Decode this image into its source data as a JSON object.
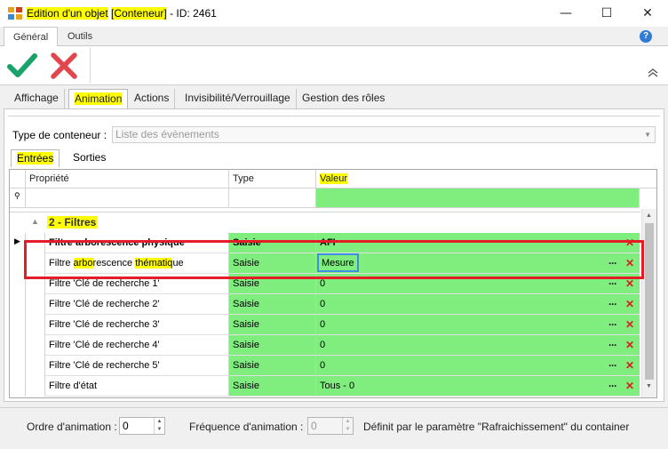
{
  "window": {
    "title_prefix": "Edition d'un ",
    "title_objet": "objet",
    "title_sep": " ",
    "title_conteneur": "[Conteneur]",
    "title_id": " - ID: 2461",
    "minimize": "—",
    "maximize": "☐",
    "close": "✕"
  },
  "ribbon": {
    "tabs": [
      "Général",
      "Outils"
    ],
    "help": "?"
  },
  "tabs": [
    "Affichage",
    "Animation",
    "Actions",
    "Invisibilité/Verrouillage",
    "Gestion des rôles"
  ],
  "type_conteneur": {
    "label": "Type de conteneur :",
    "value": "Liste des évènements"
  },
  "subtabs": [
    "Entrées",
    "Sorties"
  ],
  "grid": {
    "headers": {
      "prop": "Propriété",
      "type": "Type",
      "valeur": "Valeur"
    },
    "group": "2 - Filtres",
    "rows": [
      {
        "prop": "Filtre arborescence physique",
        "type": "Saisie",
        "value": "AFI"
      },
      {
        "prop_a": "Filtre ",
        "prop_b": "arbo",
        "prop_c": "rescence ",
        "prop_d": "thématiq",
        "prop_e": "ue",
        "type": "Saisie",
        "value": "Mesure"
      },
      {
        "prop": "Filtre 'Clé de recherche 1'",
        "type": "Saisie",
        "value": "0"
      },
      {
        "prop": "Filtre 'Clé de recherche 2'",
        "type": "Saisie",
        "value": "0"
      },
      {
        "prop": "Filtre 'Clé de recherche 3'",
        "type": "Saisie",
        "value": "0"
      },
      {
        "prop": "Filtre 'Clé de recherche 4'",
        "type": "Saisie",
        "value": "0"
      },
      {
        "prop": "Filtre 'Clé de recherche 5'",
        "type": "Saisie",
        "value": "0"
      },
      {
        "prop": "Filtre d'état",
        "type": "Saisie",
        "value": "Tous - 0"
      }
    ],
    "dots": "···",
    "delete": "✕"
  },
  "bottom": {
    "ordre_label": "Ordre d'animation :",
    "ordre_value": "0",
    "freq_label": "Fréquence d'animation :",
    "freq_value": "0",
    "desc": "Définit par le paramètre \"Rafraichissement\" du container"
  }
}
